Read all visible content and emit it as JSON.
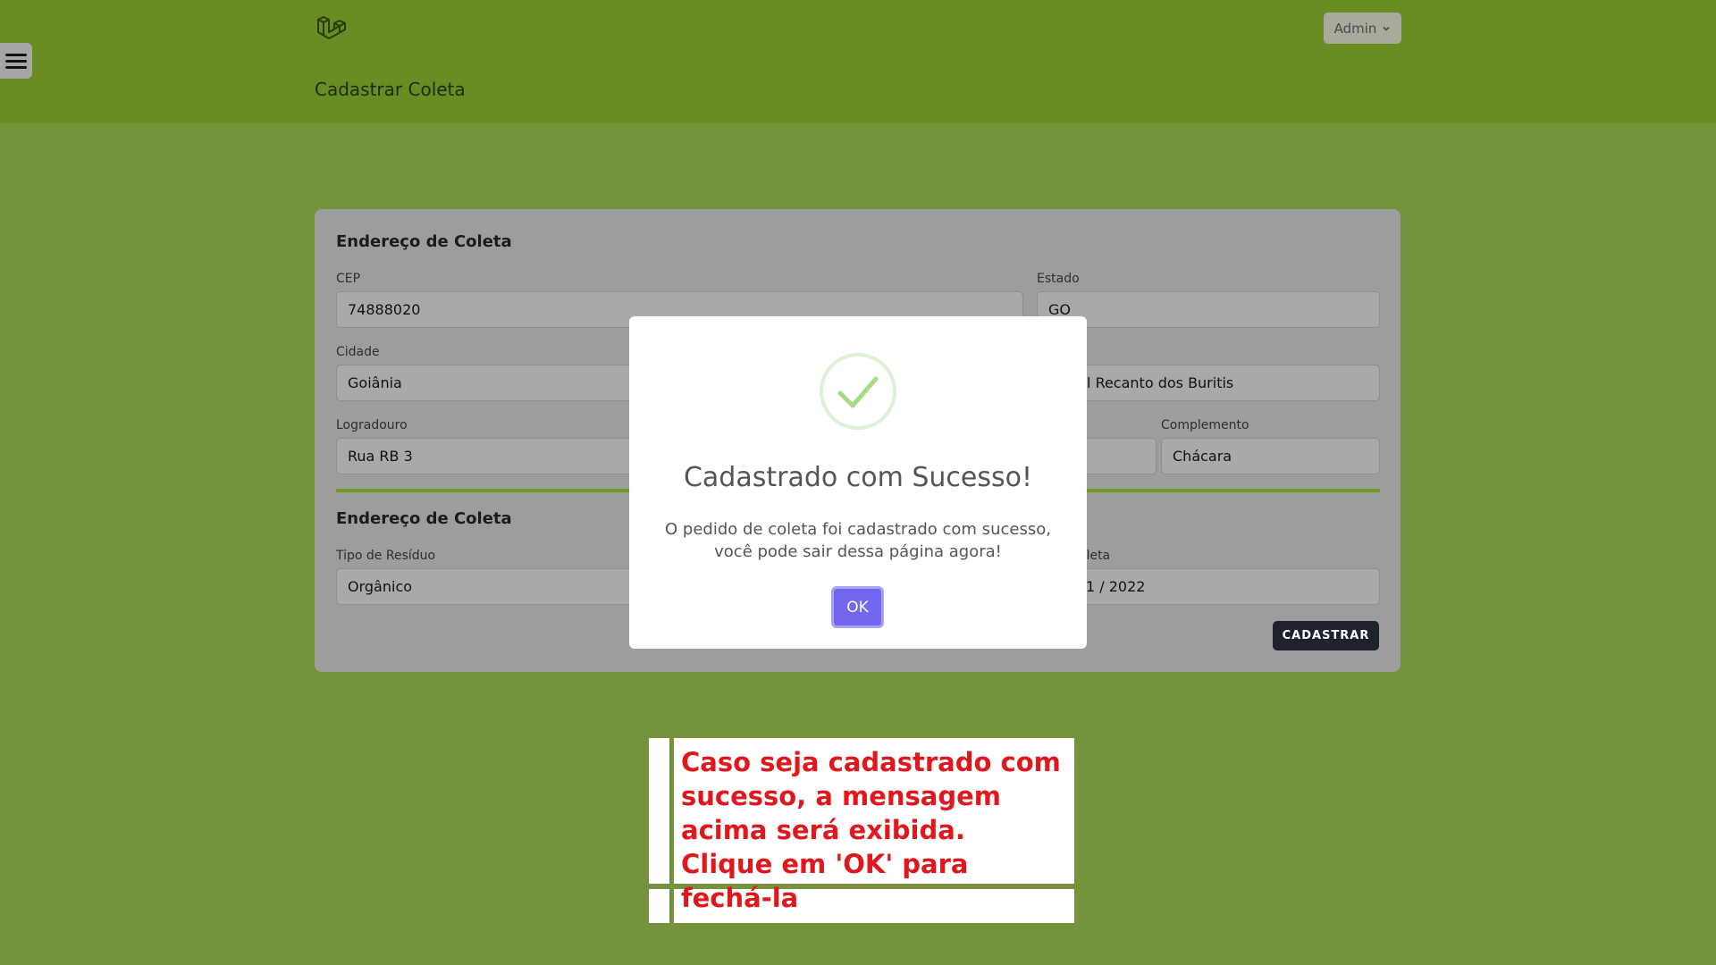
{
  "header": {
    "logo_icon": "laravel-logo-icon",
    "user_menu_label": "Admin",
    "page_title": "Cadastrar Coleta",
    "menu_icon": "hamburger-menu-icon"
  },
  "form": {
    "section1_title": "Endereço de Coleta",
    "cep": {
      "label": "CEP",
      "value": "74888020"
    },
    "estado": {
      "label": "Estado",
      "value": "GO"
    },
    "cidade": {
      "label": "Cidade",
      "value": "Goiânia"
    },
    "bairro": {
      "value": "encial Recanto dos Buritis"
    },
    "logradouro": {
      "label": "Logradouro",
      "value": "Rua RB 3"
    },
    "complemento": {
      "label": "Complemento",
      "value": "Chácara"
    },
    "section2_title": "Endereço de Coleta",
    "tipo_residuo": {
      "label": "Tipo de Resíduo",
      "value": "Orgânico"
    },
    "data_coleta": {
      "label": "oleta",
      "value": "1 / 2022"
    },
    "submit_label": "CADASTRAR"
  },
  "modal": {
    "icon": "success-check-icon",
    "title": "Cadastrado com Sucesso!",
    "message": "O pedido de coleta foi cadastrado com sucesso, você pode sair dessa página agora!",
    "ok_label": "OK"
  },
  "annotation": {
    "text": "Caso seja cadastrado com sucesso, a mensagem acima será exibida. Clique em 'OK' para fechá-la"
  },
  "colors": {
    "header_bg": "#6a8d23",
    "page_bg": "#75933c",
    "accent_green": "#6e9a1f",
    "ok_button": "#7367f0",
    "submit_button": "#1e222c",
    "annotation_text": "#e0171d"
  }
}
